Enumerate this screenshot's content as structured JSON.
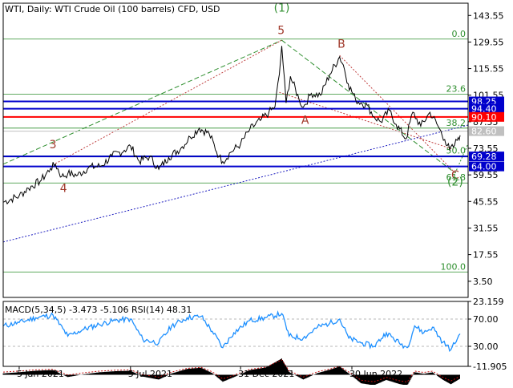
{
  "chart_data": [
    {
      "type": "line",
      "title": "WTI, Daily:  WTI Crude Oil (100 barrels) CFD, USD",
      "x_tick_labels": [
        "5 Jan 2021",
        "5 Jul 2021",
        "31 Dec 2021",
        "30 Jun 2022"
      ],
      "x_tick_dates": [
        "2021-01-05",
        "2021-07-05",
        "2021-12-31",
        "2022-06-30"
      ],
      "x_range": [
        "2020-12-10",
        "2023-01-05"
      ],
      "ylim": [
        -5,
        150
      ],
      "y_tick_labels": [
        "143.55",
        "129.55",
        "115.55",
        "101.55",
        "87.55",
        "73.55",
        "59.55",
        "45.55",
        "31.55",
        "17.55",
        "3.50"
      ],
      "y_tick_values": [
        143.55,
        129.55,
        115.55,
        101.55,
        87.55,
        73.55,
        59.55,
        45.55,
        31.55,
        17.55,
        3.5
      ],
      "price_series": [
        [
          "2020-12-10",
          45.2
        ],
        [
          "2021-01-05",
          48.5
        ],
        [
          "2021-01-20",
          52.5
        ],
        [
          "2021-02-10",
          56.8
        ],
        [
          "2021-02-25",
          63.0
        ],
        [
          "2021-03-05",
          65.2
        ],
        [
          "2021-03-15",
          58.6
        ],
        [
          "2021-03-25",
          60.2
        ],
        [
          "2021-04-10",
          59.4
        ],
        [
          "2021-04-28",
          63.5
        ],
        [
          "2021-05-18",
          64.2
        ],
        [
          "2021-06-05",
          69.5
        ],
        [
          "2021-06-25",
          72.5
        ],
        [
          "2021-07-05",
          74.8
        ],
        [
          "2021-07-19",
          66.8
        ],
        [
          "2021-08-05",
          69.2
        ],
        [
          "2021-08-20",
          62.5
        ],
        [
          "2021-09-05",
          68.8
        ],
        [
          "2021-09-25",
          73.6
        ],
        [
          "2021-10-10",
          79.5
        ],
        [
          "2021-10-25",
          84.2
        ],
        [
          "2021-11-10",
          81.2
        ],
        [
          "2021-11-26",
          69.2
        ],
        [
          "2021-12-02",
          66.6
        ],
        [
          "2021-12-15",
          71.5
        ],
        [
          "2021-12-31",
          75.8
        ],
        [
          "2022-01-15",
          83.5
        ],
        [
          "2022-02-01",
          88.2
        ],
        [
          "2022-02-15",
          92.4
        ],
        [
          "2022-02-25",
          95.5
        ],
        [
          "2022-03-04",
          112.5
        ],
        [
          "2022-03-08",
          127.5
        ],
        [
          "2022-03-15",
          97.5
        ],
        [
          "2022-03-22",
          111.5
        ],
        [
          "2022-04-05",
          99.5
        ],
        [
          "2022-04-12",
          95.2
        ],
        [
          "2022-04-25",
          102.5
        ],
        [
          "2022-05-10",
          101.5
        ],
        [
          "2022-05-25",
          112.5
        ],
        [
          "2022-06-10",
          121.8
        ],
        [
          "2022-06-16",
          117.5
        ],
        [
          "2022-06-24",
          107.5
        ],
        [
          "2022-07-06",
          99.2
        ],
        [
          "2022-07-15",
          97.5
        ],
        [
          "2022-07-25",
          96.2
        ],
        [
          "2022-08-05",
          90.2
        ],
        [
          "2022-08-16",
          87.5
        ],
        [
          "2022-08-30",
          93.5
        ],
        [
          "2022-09-10",
          86.2
        ],
        [
          "2022-09-26",
          78.5
        ],
        [
          "2022-10-07",
          92.6
        ],
        [
          "2022-10-20",
          85.2
        ],
        [
          "2022-11-04",
          92.5
        ],
        [
          "2022-11-15",
          86.5
        ],
        [
          "2022-11-28",
          78.2
        ],
        [
          "2022-12-06",
          72.8
        ],
        [
          "2022-12-12",
          74.2
        ],
        [
          "2022-12-20",
          79.2
        ],
        [
          "2022-12-23",
          80.4
        ]
      ],
      "levels": [
        {
          "label": "98.25",
          "value": 98.25,
          "color": "#0000cc",
          "type": "horizontal-line"
        },
        {
          "label": "94.40",
          "value": 94.4,
          "color": "#0000cc",
          "type": "horizontal-line"
        },
        {
          "label": "90.10",
          "value": 90.1,
          "color": "#ff0000",
          "type": "horizontal-line"
        },
        {
          "label": "82.60",
          "value": 82.6,
          "color": "#c0c0c0",
          "type": "current-price"
        },
        {
          "label": "69.28",
          "value": 69.28,
          "color": "#0000cc",
          "type": "horizontal-line"
        },
        {
          "label": "64.00",
          "value": 64.0,
          "color": "#0000cc",
          "type": "horizontal-line"
        }
      ],
      "fibonacci": {
        "color": "#2f8f2f",
        "levels": [
          {
            "label": "0.0",
            "value": 131.1
          },
          {
            "label": "23.6",
            "value": 102.0
          },
          {
            "label": "38.2",
            "value": 84.2
          },
          {
            "label": "50.0",
            "value": 69.6
          },
          {
            "label": "61.8",
            "value": 55.3
          },
          {
            "label": "100.0",
            "value": 8.4
          }
        ]
      },
      "wave_labels": [
        {
          "text": "(1)",
          "x": "2022-03-08",
          "y": 145.5,
          "color": "#2f8f2f"
        },
        {
          "text": "5",
          "x": "2022-03-07",
          "y": 133.8,
          "color": "#a0382a"
        },
        {
          "text": "B",
          "x": "2022-06-13",
          "y": 126.5,
          "color": "#a0382a"
        },
        {
          "text": "A",
          "x": "2022-04-15",
          "y": 86.5,
          "color": "#a0382a"
        },
        {
          "text": "3",
          "x": "2021-03-01",
          "y": 73.5,
          "color": "#a0382a"
        },
        {
          "text": "4",
          "x": "2021-03-18",
          "y": 50.5,
          "color": "#a0382a"
        },
        {
          "text": "C",
          "x": "2022-12-15",
          "y": 57.5,
          "color": "#a0382a"
        },
        {
          "text": "(2)",
          "x": "2022-12-15",
          "y": 54.0,
          "color": "#2f8f2f"
        }
      ],
      "trend_lines": [
        {
          "from": [
            "2020-12-10",
            65.2
          ],
          "to": [
            "2022-03-08",
            130.5
          ],
          "color": "#2f8f2f",
          "style": "dashed"
        },
        {
          "from": [
            "2021-03-05",
            65.5
          ],
          "to": [
            "2022-03-08",
            130.5
          ],
          "color": "#c04040",
          "style": "dotted"
        },
        {
          "from": [
            "2022-03-08",
            130.5
          ],
          "to": [
            "2022-12-15",
            60.5
          ],
          "color": "#2f8f2f",
          "style": "dashed"
        },
        {
          "from": [
            "2022-06-10",
            122.5
          ],
          "to": [
            "2022-12-15",
            60.5
          ],
          "color": "#c04040",
          "style": "dotted"
        },
        {
          "from": [
            "2022-03-04",
            103.0
          ],
          "to": [
            "2022-12-12",
            73.0
          ],
          "color": "#c04040",
          "style": "dotted"
        },
        {
          "from": [
            "2020-12-10",
            24.2
          ],
          "to": [
            "2023-01-05",
            85.8
          ],
          "color": "#2020c0",
          "style": "dotted"
        },
        {
          "from": [
            "2022-12-15",
            60.5
          ],
          "to": [
            "2023-01-05",
            76.0
          ],
          "color": "#2f8f2f",
          "style": "dotted"
        }
      ]
    },
    {
      "type": "line",
      "title": "MACD(5,34,5) -3.473 -5.106 RSI(14) 48.31",
      "ylim": [
        -11.905,
        23.159
      ],
      "y_tick_labels": [
        "23.159",
        "70.00",
        "30.00",
        "-11.905"
      ],
      "macd_hist_color": "#000000",
      "macd_signal_color": "#c01010",
      "rsi_color": "#1e90ff",
      "rsi_levels": [
        70,
        30
      ],
      "macd_hist": [
        [
          "2020-12-10",
          1.2
        ],
        [
          "2021-01-05",
          2.3
        ],
        [
          "2021-02-01",
          3.6
        ],
        [
          "2021-03-01",
          4.2
        ],
        [
          "2021-03-25",
          -2.0
        ],
        [
          "2021-04-20",
          0.4
        ],
        [
          "2021-05-15",
          2.2
        ],
        [
          "2021-06-10",
          3.2
        ],
        [
          "2021-07-05",
          3.6
        ],
        [
          "2021-07-25",
          -1.6
        ],
        [
          "2021-08-20",
          -4.3
        ],
        [
          "2021-09-10",
          1.2
        ],
        [
          "2021-10-05",
          5.2
        ],
        [
          "2021-10-28",
          6.3
        ],
        [
          "2021-11-15",
          1.5
        ],
        [
          "2021-12-02",
          -6.2
        ],
        [
          "2021-12-20",
          -2.2
        ],
        [
          "2022-01-15",
          4.2
        ],
        [
          "2022-02-10",
          6.5
        ],
        [
          "2022-03-08",
          14.5
        ],
        [
          "2022-03-20",
          2.5
        ],
        [
          "2022-04-12",
          -4.2
        ],
        [
          "2022-05-05",
          1.5
        ],
        [
          "2022-05-25",
          4.5
        ],
        [
          "2022-06-10",
          7.4
        ],
        [
          "2022-06-25",
          1.2
        ],
        [
          "2022-07-15",
          -7.6
        ],
        [
          "2022-08-05",
          -9.4
        ],
        [
          "2022-08-25",
          -4.6
        ],
        [
          "2022-09-15",
          -8.2
        ],
        [
          "2022-09-28",
          -9.7
        ],
        [
          "2022-10-10",
          2.3
        ],
        [
          "2022-10-25",
          0.8
        ],
        [
          "2022-11-08",
          2.2
        ],
        [
          "2022-11-25",
          -4.5
        ],
        [
          "2022-12-08",
          -8.4
        ],
        [
          "2022-12-23",
          -3.473
        ]
      ],
      "rsi_series": [
        [
          "2020-12-10",
          60
        ],
        [
          "2021-01-05",
          65
        ],
        [
          "2021-02-01",
          72
        ],
        [
          "2021-03-01",
          76
        ],
        [
          "2021-03-25",
          45
        ],
        [
          "2021-04-20",
          55
        ],
        [
          "2021-05-15",
          62
        ],
        [
          "2021-06-10",
          68
        ],
        [
          "2021-07-05",
          70
        ],
        [
          "2021-07-25",
          40
        ],
        [
          "2021-08-20",
          35
        ],
        [
          "2021-09-10",
          60
        ],
        [
          "2021-10-05",
          72
        ],
        [
          "2021-10-28",
          74
        ],
        [
          "2021-11-15",
          52
        ],
        [
          "2021-12-02",
          28
        ],
        [
          "2021-12-20",
          50
        ],
        [
          "2022-01-15",
          68
        ],
        [
          "2022-02-10",
          72
        ],
        [
          "2022-03-08",
          78
        ],
        [
          "2022-03-20",
          45
        ],
        [
          "2022-04-12",
          42
        ],
        [
          "2022-05-05",
          58
        ],
        [
          "2022-05-25",
          64
        ],
        [
          "2022-06-10",
          70
        ],
        [
          "2022-06-25",
          42
        ],
        [
          "2022-07-15",
          35
        ],
        [
          "2022-08-05",
          30
        ],
        [
          "2022-08-25",
          50
        ],
        [
          "2022-09-15",
          35
        ],
        [
          "2022-09-28",
          28
        ],
        [
          "2022-10-10",
          60
        ],
        [
          "2022-10-25",
          50
        ],
        [
          "2022-11-08",
          58
        ],
        [
          "2022-11-25",
          36
        ],
        [
          "2022-12-08",
          25
        ],
        [
          "2022-12-23",
          48.31
        ]
      ]
    }
  ]
}
